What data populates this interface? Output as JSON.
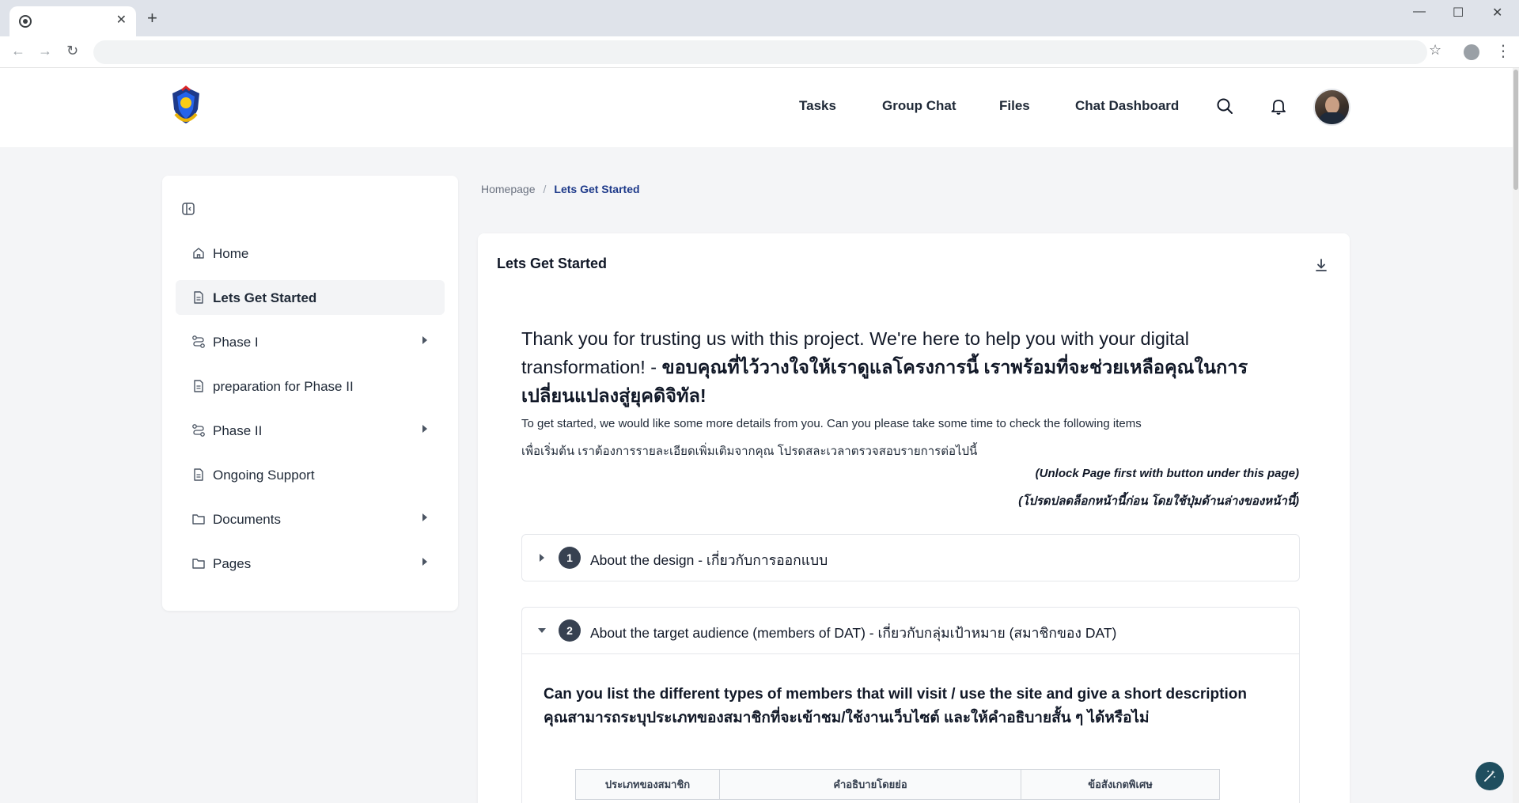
{
  "browser": {
    "tab_close": "✕",
    "new_tab": "+",
    "window_controls": [
      "—",
      "☐",
      "✕"
    ]
  },
  "header": {
    "nav": [
      "Tasks",
      "Group Chat",
      "Files",
      "Chat Dashboard"
    ]
  },
  "sidebar": {
    "items": [
      {
        "label": "Home",
        "icon": "home-icon",
        "has_children": false,
        "active": false
      },
      {
        "label": "Lets Get Started",
        "icon": "document-icon",
        "has_children": false,
        "active": true
      },
      {
        "label": "Phase I",
        "icon": "route-icon",
        "has_children": true,
        "active": false
      },
      {
        "label": "preparation for Phase II",
        "icon": "document-icon",
        "has_children": false,
        "active": false
      },
      {
        "label": "Phase II",
        "icon": "route-icon",
        "has_children": true,
        "active": false
      },
      {
        "label": "Ongoing Support",
        "icon": "document-icon",
        "has_children": false,
        "active": false
      },
      {
        "label": "Documents",
        "icon": "folder-icon",
        "has_children": true,
        "active": false
      },
      {
        "label": "Pages",
        "icon": "folder-icon",
        "has_children": true,
        "active": false
      }
    ]
  },
  "breadcrumb": {
    "home": "Homepage",
    "separator": "/",
    "current": "Lets Get Started"
  },
  "main": {
    "title": "Lets Get Started",
    "headline_en": "Thank you for trusting us with this project. We're here to help you with your digital transformation! - ",
    "headline_th": "ขอบคุณที่ไว้วางใจให้เราดูแลโครงการนี้ เราพร้อมที่จะช่วยเหลือคุณในการเปลี่ยนแปลงสู่ยุคดิจิทัล!",
    "intro_en": "To get started, we would like some more details from you. Can you please take some time to check the following items",
    "intro_th": "เพื่อเริ่มต้น เราต้องการรายละเอียดเพิ่มเติมจากคุณ โปรดสละเวลาตรวจสอบรายการต่อไปนี้",
    "unlock_en": "(Unlock Page first with button under this page)",
    "unlock_th": "(โปรดปลดล็อกหน้านี้ก่อน โดยใช้ปุ่มด้านล่างของหน้านี้)",
    "sections": [
      {
        "number": "1",
        "title": "About the design - เกี่ยวกับการออกแบบ",
        "expanded": false
      },
      {
        "number": "2",
        "title": "About the target audience (members of DAT) - เกี่ยวกับกลุ่มเป้าหมาย (สมาชิกของ DAT)",
        "expanded": true
      }
    ],
    "question_en": "Can you list the different types of members that will visit / use the site and give a short description",
    "question_th": "คุณสามารถระบุประเภทของสมาชิกที่จะเข้าชม/ใช้งานเว็บไซต์ และให้คำอธิบายสั้น ๆ ได้หรือไม่",
    "table_headers": [
      "ประเภทของสมาชิก",
      "คำอธิบายโดยย่อ",
      "ข้อสังเกตพิเศษ"
    ]
  }
}
